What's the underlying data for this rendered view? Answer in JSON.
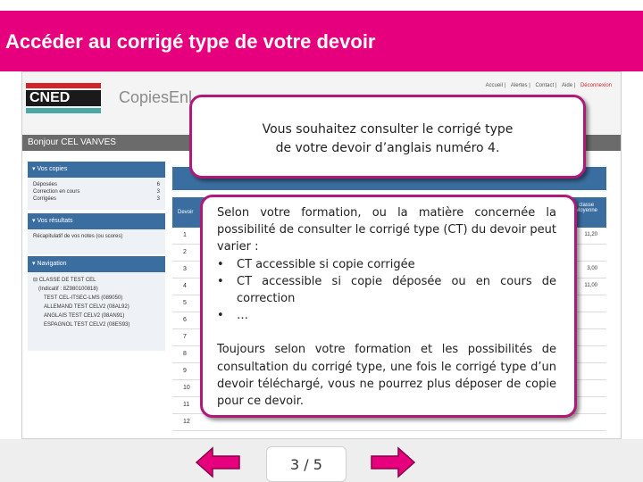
{
  "slide": {
    "title": "Accéder au corrigé type de votre devoir",
    "page_indicator": "3 / 5",
    "accent_color": "#e6007e"
  },
  "screenshot": {
    "logo_text": "CNED",
    "app_name": "CopiesEnl",
    "top_links": [
      "Accueil",
      "Alertes",
      "Contact",
      "Aide",
      "Déconnexion"
    ],
    "greeting": "Bonjour CEL VANVES",
    "vos_copies": {
      "heading": "▾ Vos copies",
      "rows": [
        {
          "label": "Déposées",
          "count": "6"
        },
        {
          "label": "Correction en cours",
          "count": "3"
        },
        {
          "label": "Corrigées",
          "count": "3"
        }
      ]
    },
    "vos_resultats": {
      "heading": "▾ Vos résultats",
      "link": "Récapitulatif de vos notes (ou scores)"
    },
    "navigation": {
      "heading": "▾ Navigation",
      "tree": [
        "⊟ CLASSE DE TEST CEL",
        "(Indicatif : 8Z980100818)",
        "TEST CEL-ITSEC-LMS (089050)",
        "ALLEMAND TEST CELV2 (08AL92)",
        "ANGLAIS TEST CELV2 (08AN91)",
        "ESPAGNOL TEST CELV2 (08ES93)"
      ]
    },
    "grid": {
      "col_devoir": "Devoir",
      "col_right": "classe\nMoyenne",
      "rows": [
        {
          "num": "1",
          "right": "11,20"
        },
        {
          "num": "2",
          "right": ""
        },
        {
          "num": "3",
          "right": "3,00"
        },
        {
          "num": "4",
          "right": "11,00"
        },
        {
          "num": "5",
          "right": ""
        },
        {
          "num": "6",
          "right": ""
        },
        {
          "num": "7",
          "right": ""
        },
        {
          "num": "8",
          "right": ""
        },
        {
          "num": "9",
          "right": ""
        },
        {
          "num": "10",
          "right": ""
        },
        {
          "num": "11",
          "right": ""
        },
        {
          "num": "12",
          "right": ""
        }
      ]
    }
  },
  "callout_top": {
    "line1": "Vous souhaitez consulter le corrigé type",
    "line2": "de votre devoir d’anglais numéro 4."
  },
  "callout_main": {
    "intro": "Selon votre formation, ou la matière concernée la possibilité de consulter le corrigé type (CT) du devoir peut varier :",
    "bullets": [
      "CT accessible si copie corrigée",
      "CT accessible si copie déposée ou en cours de correction",
      "…"
    ],
    "outro": "Toujours selon votre formation et les possibilités de consultation du corrigé type, une fois le corrigé type d’un devoir téléchargé, vous ne pourrez plus déposer de copie pour ce devoir."
  },
  "nav": {
    "prev_icon": "arrow-left-icon",
    "next_icon": "arrow-right-icon"
  }
}
